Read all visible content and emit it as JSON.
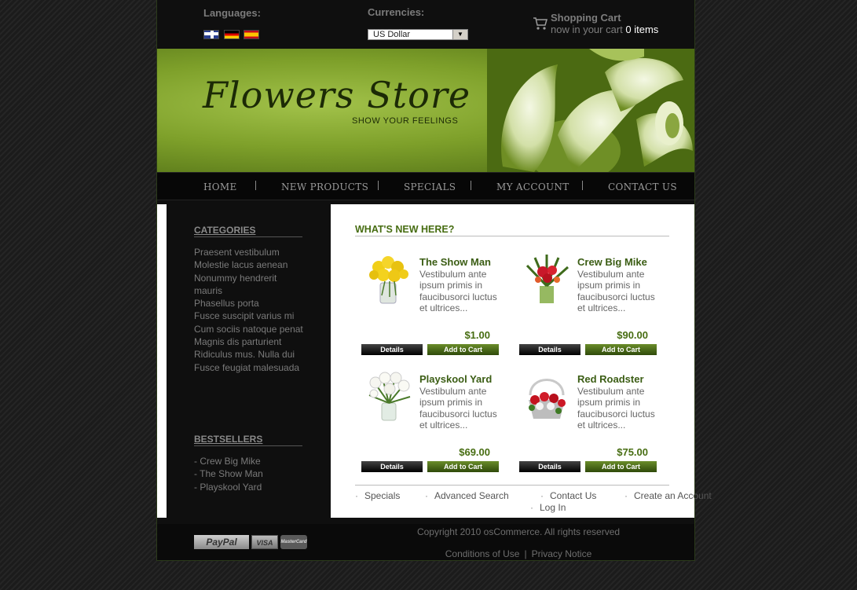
{
  "top_bar": {
    "languages_label": "Languages:",
    "languages": [
      {
        "name": "English",
        "icon": "uk-flag-icon"
      },
      {
        "name": "Deutsch",
        "icon": "german-flag-icon"
      },
      {
        "name": "Español",
        "icon": "spanish-flag-icon"
      }
    ],
    "currencies_label": "Currencies:",
    "currency_selected": "US Dollar",
    "cart_title": "Shopping Cart",
    "cart_prefix": "now in your cart",
    "cart_count": "0 items"
  },
  "banner": {
    "title": "Flowers Store",
    "tagline": "SHOW YOUR FEELINGS"
  },
  "nav": [
    "HOME",
    "NEW PRODUCTS",
    "SPECIALS",
    "MY ACCOUNT",
    "CONTACT US"
  ],
  "sidebar": {
    "categories_title": "CATEGORIES",
    "categories": [
      "Praesent vestibulum",
      "Molestie lacus aenean",
      "Nonummy hendrerit mauris",
      "Phasellus porta",
      "Fusce suscipit varius mi",
      "Cum sociis natoque penat",
      "Magnis dis parturient",
      "Ridiculus mus. Nulla dui",
      "Fusce feugiat malesuada"
    ],
    "bestsellers_title": "BESTSELLERS",
    "bestsellers": [
      "- Crew Big Mike",
      "- The Show Man",
      "- Playskool Yard"
    ]
  },
  "main": {
    "heading": "WHAT'S NEW HERE?",
    "details_label": "Details",
    "add_to_cart_label": "Add to Cart",
    "products": [
      {
        "name": "The Show Man",
        "desc": "Vestibulum ante ipsum primis in faucibusorci luctus et ultrices...",
        "price": "$1.00",
        "image": "yellow-roses-image"
      },
      {
        "name": "Crew Big Mike",
        "desc": "Vestibulum ante ipsum primis in faucibusorci luctus et ultrices...",
        "price": "$90.00",
        "image": "red-flowers-vase-image"
      },
      {
        "name": "Playskool Yard",
        "desc": "Vestibulum ante ipsum primis in faucibusorci luctus et ultrices...",
        "price": "$69.00",
        "image": "white-lilies-image"
      },
      {
        "name": "Red Roadster",
        "desc": "Vestibulum ante ipsum primis in faucibusorci luctus et ultrices...",
        "price": "$75.00",
        "image": "red-rose-basket-image"
      }
    ],
    "footer_links": [
      "Specials",
      "Advanced Search",
      "Contact Us",
      "Create an Account",
      "Log In"
    ]
  },
  "footer": {
    "payment_logos": [
      "PayPal",
      "VISA",
      "MasterCard"
    ],
    "copyright": "Copyright 2010   osCommerce. All rights reserved",
    "conditions": "Conditions of Use",
    "separator": "|",
    "privacy": "Privacy Notice"
  }
}
